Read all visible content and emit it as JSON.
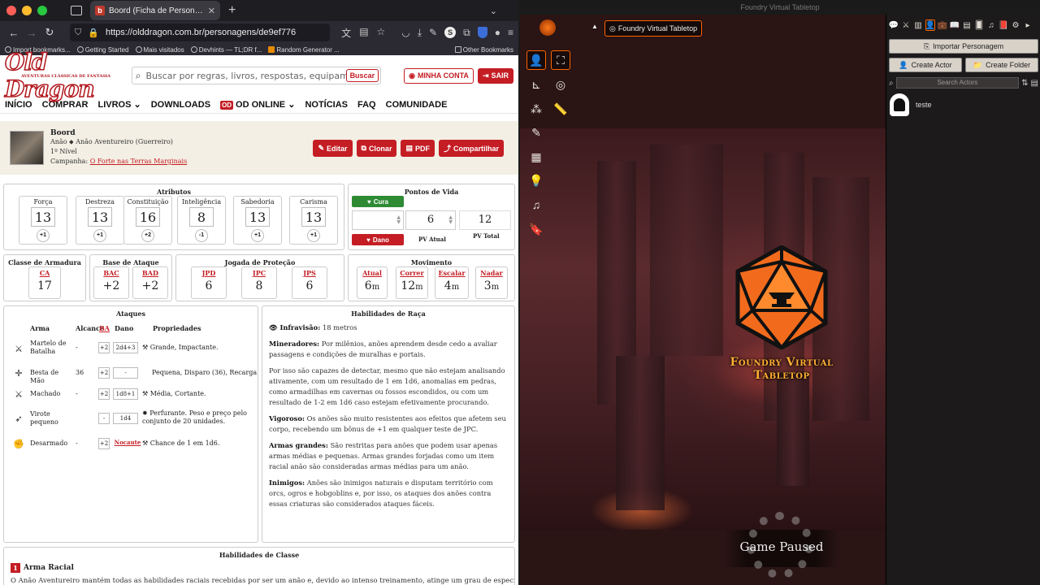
{
  "browser": {
    "tab_title": "Boord (Ficha de Personagem d",
    "tab_favicon": "b",
    "url": "https://olddragon.com.br/personagens/de9ef776",
    "bookmarks": [
      "Import bookmarks...",
      "Getting Started",
      "Mais visitados",
      "Devhints — TL;DR f...",
      "Random Generator ..."
    ],
    "bookmarks_right": "Other Bookmarks"
  },
  "site": {
    "logo": "Old Dragon",
    "logo_sub": "AVENTURAS CLÁSSICAS DE FANTASIA",
    "search_placeholder": "Buscar por regras, livros, respostas, equipamentos, mag",
    "search_button": "Buscar",
    "account_button": "MINHA CONTA",
    "logout_button": "SAIR",
    "nav": [
      "INÍCIO",
      "COMPRAR",
      "LIVROS",
      "DOWNLOADS",
      "OD ONLINE",
      "NOTÍCIAS",
      "FAQ",
      "COMUNIDADE"
    ],
    "nav_badge": "OD"
  },
  "character": {
    "name": "Boord",
    "race_class": "Anão ⬥ Anão Aventureiro (Guerreiro)",
    "level": "1º Nível",
    "campaign_label": "Campanha:",
    "campaign": "O Forte nas Terras Marginais",
    "actions": [
      "Editar",
      "Clonar",
      "PDF",
      "Compartilhar"
    ]
  },
  "attributes": {
    "title": "Atributos",
    "items": [
      {
        "name": "Força",
        "value": "13",
        "mod": "+1"
      },
      {
        "name": "Destreza",
        "value": "13",
        "mod": "+1"
      },
      {
        "name": "Constituição",
        "value": "16",
        "mod": "+2"
      },
      {
        "name": "Inteligência",
        "value": "8",
        "mod": "-1"
      },
      {
        "name": "Sabedoria",
        "value": "13",
        "mod": "+1"
      },
      {
        "name": "Carisma",
        "value": "13",
        "mod": "+1"
      }
    ]
  },
  "hp": {
    "title": "Pontos de Vida",
    "heal": "Cura",
    "damage": "Dano",
    "current": "6",
    "total": "12",
    "current_label": "PV Atual",
    "total_label": "PV Total"
  },
  "armor": {
    "title": "Classe de Armadura",
    "label": "CA",
    "value": "17"
  },
  "attack_base": {
    "title": "Base de Ataque",
    "items": [
      {
        "label": "BAC",
        "value": "+2"
      },
      {
        "label": "BAD",
        "value": "+2"
      }
    ]
  },
  "saves": {
    "title": "Jogada de Proteção",
    "items": [
      {
        "label": "JPD",
        "value": "6"
      },
      {
        "label": "JPC",
        "value": "8"
      },
      {
        "label": "JPS",
        "value": "6"
      }
    ]
  },
  "movement": {
    "title": "Movimento",
    "items": [
      {
        "label": "Atual",
        "value": "6",
        "unit": "m"
      },
      {
        "label": "Correr",
        "value": "12",
        "unit": "m"
      },
      {
        "label": "Escalar",
        "value": "4",
        "unit": "m"
      },
      {
        "label": "Nadar",
        "value": "3",
        "unit": "m"
      }
    ]
  },
  "attacks": {
    "title": "Ataques",
    "headers": {
      "weapon": "Arma",
      "range": "Alcance",
      "ba": "BA",
      "damage": "Dano",
      "props": "Propriedades"
    },
    "rows": [
      {
        "icon": "⚔",
        "name": "Martelo de Batalha",
        "range": "-",
        "ba": "+2",
        "damage": "2d4+3",
        "props": "Grande, Impactante."
      },
      {
        "icon": "✛",
        "name": "Besta de Mão",
        "range": "36",
        "ba": "+2",
        "damage": "-",
        "props": "Pequena, Disparo (36), Recarga"
      },
      {
        "icon": "⚔",
        "name": "Machado",
        "range": "-",
        "ba": "+2",
        "damage": "1d8+1",
        "props": "Média, Cortante."
      },
      {
        "icon": "➶",
        "name": "Virote pequeno",
        "range": "",
        "ba": "-",
        "damage": "1d4",
        "props": "Perfurante. Peso e preço pelo conjunto de 20 unidades."
      },
      {
        "icon": "✊",
        "name": "Desarmado",
        "range": "-",
        "ba": "+2",
        "damage": "Nocaute",
        "props": "Chance de 1 em 1d6."
      }
    ]
  },
  "race_abilities": {
    "title": "Habilidades de Raça",
    "infravision_label": "Infravisão:",
    "infravision": "18 metros",
    "paragraphs": [
      {
        "bold": "Mineradores:",
        "text": "Por milênios, anões aprendem desde cedo a avaliar passagens e condições de muralhas e portais."
      },
      {
        "bold": "",
        "text": "Por isso são capazes de detectar, mesmo que não estejam analisando ativamente, com um resultado de 1 em 1d6, anomalias em pedras, como armadilhas em cavernas ou fossos escondidos, ou com um resultado de 1-2 em 1d6 caso estejam efetivamente procurando."
      },
      {
        "bold": "Vigoroso:",
        "text": "Os anões são muito resistentes aos efeitos que afetem seu corpo, recebendo um bônus de +1 em qualquer teste de JPC."
      },
      {
        "bold": "Armas grandes:",
        "text": "São restritas para anões que podem usar apenas armas médias e pequenas. Armas grandes forjadas como um item racial anão são consideradas armas médias para um anão."
      },
      {
        "bold": "Inimigos:",
        "text": "Anões são inimigos naturais e disputam território com orcs, ogros e hobgoblins e, por isso, os ataques dos anões contra essas criaturas são considerados ataques fáceis."
      }
    ]
  },
  "class_abilities": {
    "title": "Habilidades de Classe",
    "num": "1",
    "first": "Arma Racial",
    "first_text": "O Anão Aventureiro mantém todas as habilidades raciais recebidas por ser um anão e, devido ao intenso treinamento, atinge um grau de especialização"
  },
  "foundry": {
    "window_title": "Foundry Virtual Tabletop",
    "scene_name": "Foundry Virtual Tabletop",
    "logo_text": "Foundry Virtual Tabletop",
    "paused": "Game Paused",
    "sidebar": {
      "import_button": "Importar Personagem",
      "create_actor": "Create Actor",
      "create_folder": "Create Folder",
      "search_placeholder": "Search Actors",
      "actor": "teste"
    },
    "accent": "#ff6400"
  }
}
